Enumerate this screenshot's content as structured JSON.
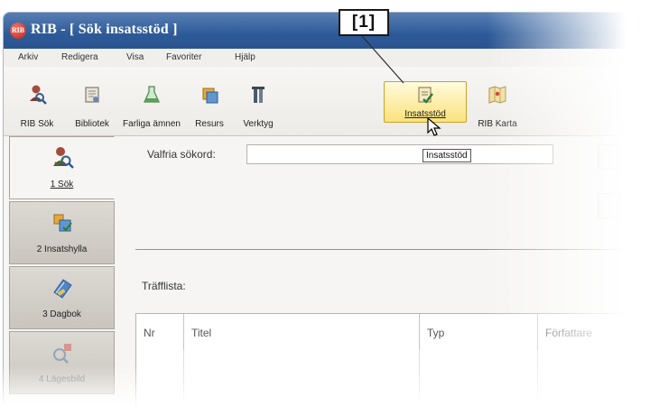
{
  "window": {
    "title": "RIB - [ Sök insatsstöd ]",
    "logo_text": "RIB"
  },
  "menu": [
    "Arkiv",
    "Redigera",
    "Visa",
    "Favoriter",
    "Hjälp"
  ],
  "toolbar": {
    "items": [
      {
        "label": "RIB Sök",
        "icon": "search-person-icon"
      },
      {
        "label": "Bibliotek",
        "icon": "library-icon"
      },
      {
        "label": "Farliga ämnen",
        "icon": "flask-icon"
      },
      {
        "label": "Resurs",
        "icon": "resource-icon"
      },
      {
        "label": "Verktyg",
        "icon": "tools-icon"
      },
      {
        "label": "Insatsstöd",
        "icon": "checklist-icon",
        "active": true
      },
      {
        "label": "RIB Karta",
        "icon": "map-icon"
      }
    ],
    "tooltip": "Insatsstöd"
  },
  "callout": "[1]",
  "sidebar": {
    "tabs": [
      {
        "label": "1 Sök",
        "icon": "search-person-icon",
        "active": true
      },
      {
        "label": "2 Insatshylla",
        "icon": "shelf-icon"
      },
      {
        "label": "3 Dagbok",
        "icon": "book-icon"
      },
      {
        "label": "4 Lägesbild",
        "icon": "situation-icon",
        "disabled": true
      }
    ]
  },
  "search": {
    "label": "Valfria sökord:",
    "value": ""
  },
  "results": {
    "label": "Träfflista:",
    "columns": [
      "Nr",
      "Titel",
      "Typ",
      "Författare"
    ]
  },
  "colors": {
    "titlebar": "#2d5a98",
    "active_button": "#fbe27b",
    "logo": "#c01f14"
  }
}
